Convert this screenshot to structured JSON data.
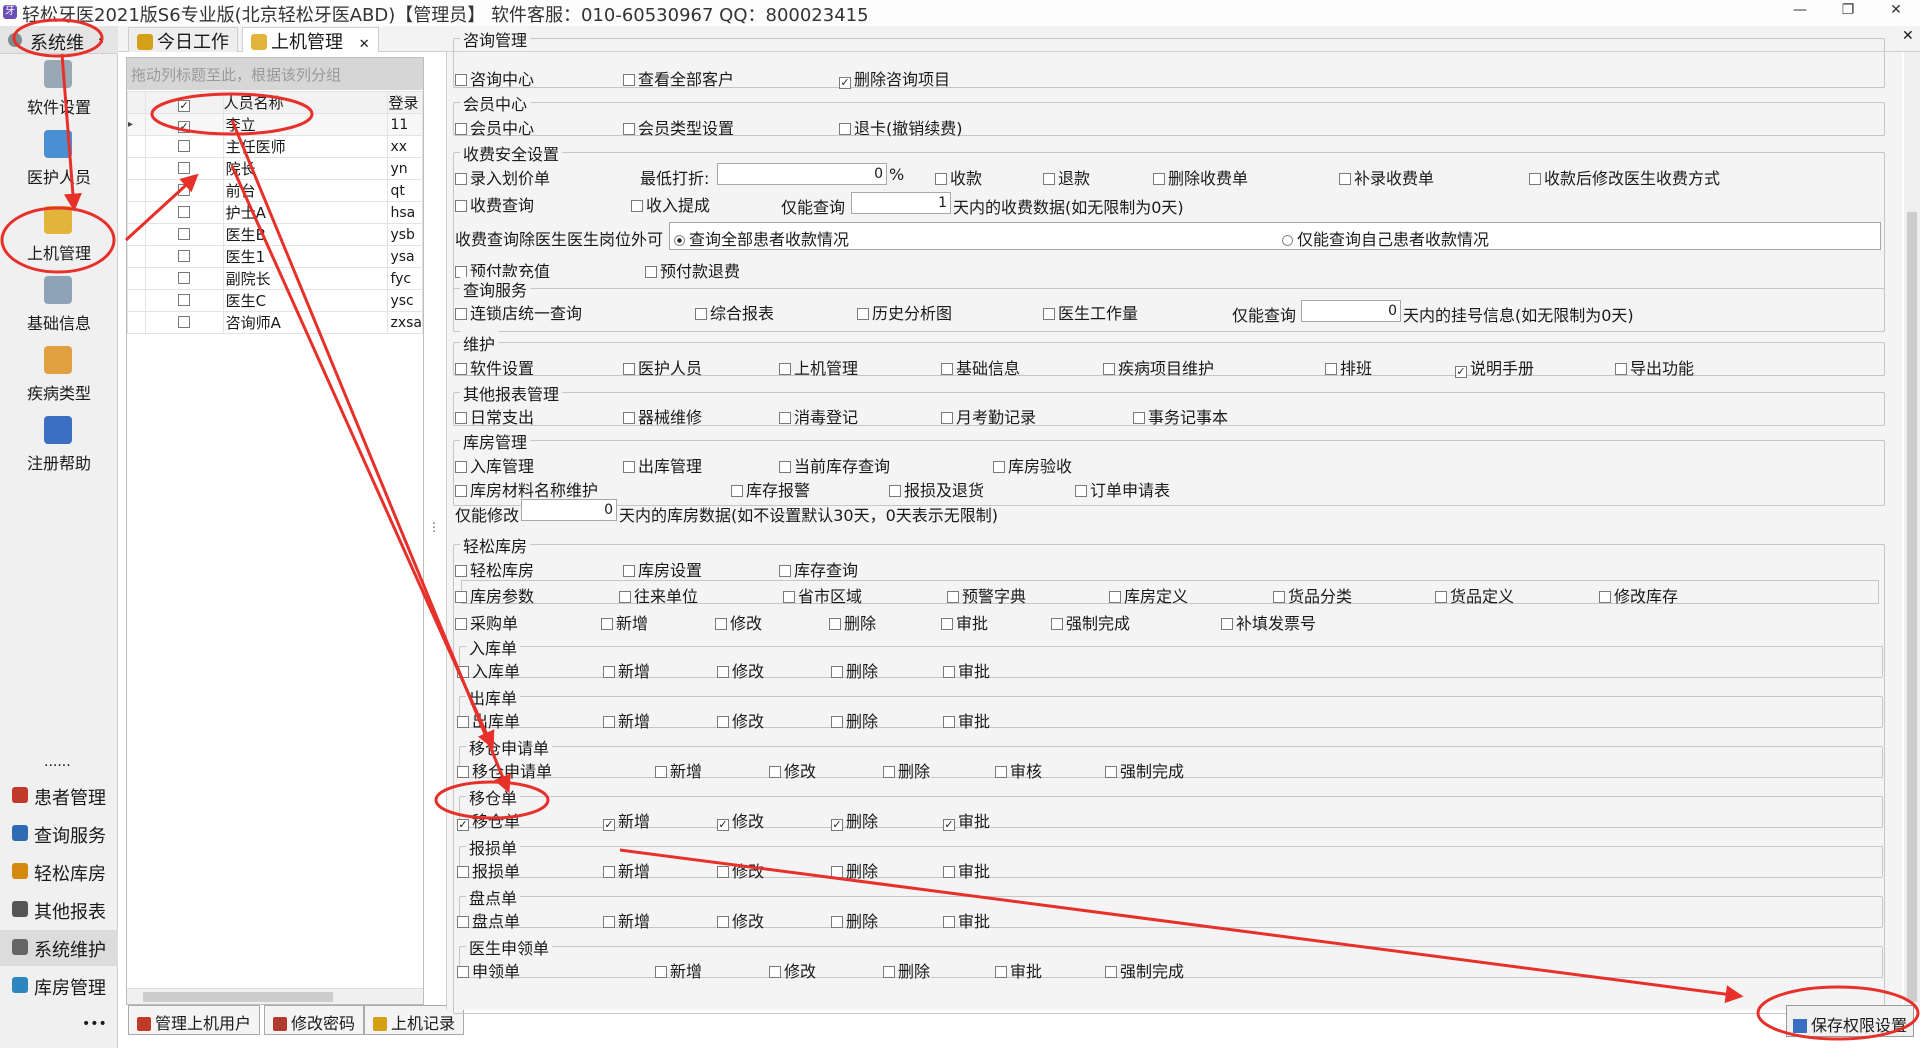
{
  "window": {
    "title": "轻松牙医2021版S6专业版(北京轻松牙医ABD)【管理员】   软件客服：010-60530967 QQ：800023415"
  },
  "leftnav": {
    "header": "系统维",
    "items": [
      {
        "label": "软件设置",
        "icon": "gear-icon"
      },
      {
        "label": "医护人员",
        "icon": "staff-icon"
      },
      {
        "label": "上机管理",
        "icon": "lock-icon"
      },
      {
        "label": "基础信息",
        "icon": "gears-icon"
      },
      {
        "label": "疾病类型",
        "icon": "tree-icon"
      },
      {
        "label": "注册帮助",
        "icon": "help-icon"
      }
    ],
    "dots": "......",
    "modules": [
      {
        "label": "患者管理",
        "color": "#c0392b"
      },
      {
        "label": "查询服务",
        "color": "#2e6bb5"
      },
      {
        "label": "轻松库房",
        "color": "#d68910"
      },
      {
        "label": "其他报表",
        "color": "#555555"
      },
      {
        "label": "系统维护",
        "color": "#666666"
      },
      {
        "label": "库房管理",
        "color": "#2e86c1"
      }
    ],
    "more": "•••"
  },
  "tabs": [
    {
      "label": "今日工作",
      "active": false
    },
    {
      "label": "上机管理",
      "active": true
    }
  ],
  "users": {
    "group_hint": "拖动列标题至此，根据该列分组",
    "col_name": "人员名称",
    "col_login": "登录",
    "rows": [
      {
        "name": "李立",
        "login": "11",
        "checked": true,
        "current": true
      },
      {
        "name": "主任医师",
        "login": "xx",
        "checked": false
      },
      {
        "name": "院长",
        "login": "yn",
        "checked": false
      },
      {
        "name": "前台",
        "login": "qt",
        "checked": false
      },
      {
        "name": "护士A",
        "login": "hsa",
        "checked": false
      },
      {
        "name": "医生B",
        "login": "ysb",
        "checked": false
      },
      {
        "name": "医生1",
        "login": "ysa",
        "checked": false
      },
      {
        "name": "副院长",
        "login": "fyc",
        "checked": false
      },
      {
        "name": "医生C",
        "login": "ysc",
        "checked": false
      },
      {
        "name": "咨询师A",
        "login": "zxsa",
        "checked": false
      }
    ]
  },
  "bottom_buttons": {
    "manage_users": "管理上机用户",
    "change_pwd": "修改密码",
    "login_log": "上机记录",
    "save": "保存权限设置"
  },
  "perm": {
    "consult": {
      "title": "咨询管理",
      "items": [
        {
          "label": "咨询中心",
          "checked": false
        },
        {
          "label": "查看全部客户",
          "checked": false
        },
        {
          "label": "删除咨询项目",
          "checked": true
        }
      ]
    },
    "member": {
      "title": "会员中心",
      "items": [
        {
          "label": "会员中心",
          "checked": false
        },
        {
          "label": "会员类型设置",
          "checked": false
        },
        {
          "label": "退卡(撤销续费)",
          "checked": false
        }
      ]
    },
    "fee": {
      "title": "收费安全设置",
      "row1": [
        {
          "label": "录入划价单",
          "checked": false
        },
        {
          "label": "收款",
          "checked": false
        },
        {
          "label": "退款",
          "checked": false
        },
        {
          "label": "删除收费单",
          "checked": false
        },
        {
          "label": "补录收费单",
          "checked": false
        },
        {
          "label": "收款后修改医生收费方式",
          "checked": false
        }
      ],
      "min_discount_label": "最低打折:",
      "min_discount_value": "0",
      "percent": "%",
      "row2": [
        {
          "label": "收费查询",
          "checked": false
        },
        {
          "label": "收入提成",
          "checked": false
        }
      ],
      "only_query": "仅能查询",
      "query_days": "1",
      "query_suffix": "天内的收费数据(如无限制为0天)",
      "scope_label": "收费查询除医生医生岗位外可",
      "scope_all": "查询全部患者收款情况",
      "scope_self": "仅能查询自己患者收款情况",
      "row3": [
        {
          "label": "预付款充值",
          "checked": false
        },
        {
          "label": "预付款退费",
          "checked": false
        }
      ]
    },
    "query": {
      "title": "查询服务",
      "items": [
        {
          "label": "连锁店统一查询",
          "checked": false
        },
        {
          "label": "综合报表",
          "checked": false
        },
        {
          "label": "历史分析图",
          "checked": false
        },
        {
          "label": "医生工作量",
          "checked": false
        }
      ],
      "only_query": "仅能查询",
      "days": "0",
      "suffix": "天内的挂号信息(如无限制为0天)"
    },
    "maint": {
      "title": "维护",
      "items": [
        {
          "label": "软件设置",
          "checked": false
        },
        {
          "label": "医护人员",
          "checked": false
        },
        {
          "label": "上机管理",
          "checked": false
        },
        {
          "label": "基础信息",
          "checked": false
        },
        {
          "label": "疾病项目维护",
          "checked": false
        },
        {
          "label": "排班",
          "checked": false
        },
        {
          "label": "说明手册",
          "checked": true
        },
        {
          "label": "导出功能",
          "checked": false
        }
      ]
    },
    "report": {
      "title": "其他报表管理",
      "items": [
        {
          "label": "日常支出",
          "checked": false
        },
        {
          "label": "器械维修",
          "checked": false
        },
        {
          "label": "消毒登记",
          "checked": false
        },
        {
          "label": "月考勤记录",
          "checked": false
        },
        {
          "label": "事务记事本",
          "checked": false
        }
      ]
    },
    "store": {
      "title": "库房管理",
      "row1": [
        {
          "label": "入库管理",
          "checked": false
        },
        {
          "label": "出库管理",
          "checked": false
        },
        {
          "label": "当前库存查询",
          "checked": false
        },
        {
          "label": "库房验收",
          "checked": false
        }
      ],
      "row2": [
        {
          "label": "库房材料名称维护",
          "checked": false
        },
        {
          "label": "库存报警",
          "checked": false
        },
        {
          "label": "报损及退货",
          "checked": false
        },
        {
          "label": "订单申请表",
          "checked": false
        }
      ],
      "only_edit": "仅能修改",
      "days": "0",
      "suffix": "天内的库房数据(如不设置默认30天，0天表示无限制)"
    },
    "easy": {
      "title": "轻松库房",
      "row1": [
        {
          "label": "轻松库房",
          "checked": false
        },
        {
          "label": "库房设置",
          "checked": false
        },
        {
          "label": "库存查询",
          "checked": false
        }
      ],
      "row2": [
        {
          "label": "库房参数",
          "checked": false
        },
        {
          "label": "往来单位",
          "checked": false
        },
        {
          "label": "省市区域",
          "checked": false
        },
        {
          "label": "预警字典",
          "checked": false
        },
        {
          "label": "库房定义",
          "checked": false
        },
        {
          "label": "货品分类",
          "checked": false
        },
        {
          "label": "货品定义",
          "checked": false
        },
        {
          "label": "修改库存",
          "checked": false
        }
      ],
      "purchase": [
        {
          "label": "采购单",
          "checked": false
        },
        {
          "label": "新增",
          "checked": false
        },
        {
          "label": "修改",
          "checked": false
        },
        {
          "label": "删除",
          "checked": false
        },
        {
          "label": "审批",
          "checked": false
        },
        {
          "label": "强制完成",
          "checked": false
        },
        {
          "label": "补填发票号",
          "checked": false
        }
      ],
      "inbound": {
        "title": "入库单",
        "items": [
          {
            "label": "入库单",
            "checked": false
          },
          {
            "label": "新增",
            "checked": false
          },
          {
            "label": "修改",
            "checked": false
          },
          {
            "label": "删除",
            "checked": false
          },
          {
            "label": "审批",
            "checked": false
          }
        ]
      },
      "outbound": {
        "title": "出库单",
        "items": [
          {
            "label": "出库单",
            "checked": false
          },
          {
            "label": "新增",
            "checked": false
          },
          {
            "label": "修改",
            "checked": false
          },
          {
            "label": "删除",
            "checked": false
          },
          {
            "label": "审批",
            "checked": false
          }
        ]
      },
      "move_req": {
        "title": "移仓申请单",
        "items": [
          {
            "label": "移仓申请单",
            "checked": false
          },
          {
            "label": "新增",
            "checked": false
          },
          {
            "label": "修改",
            "checked": false
          },
          {
            "label": "删除",
            "checked": false
          },
          {
            "label": "审核",
            "checked": false
          },
          {
            "label": "强制完成",
            "checked": false
          }
        ]
      },
      "move": {
        "title": "移仓单",
        "items": [
          {
            "label": "移仓单",
            "checked": true
          },
          {
            "label": "新增",
            "checked": true
          },
          {
            "label": "修改",
            "checked": true
          },
          {
            "label": "删除",
            "checked": true
          },
          {
            "label": "审批",
            "checked": true
          }
        ]
      },
      "loss": {
        "title": "报损单",
        "items": [
          {
            "label": "报损单",
            "checked": false
          },
          {
            "label": "新增",
            "checked": false
          },
          {
            "label": "修改",
            "checked": false
          },
          {
            "label": "删除",
            "checked": false
          },
          {
            "label": "审批",
            "checked": false
          }
        ]
      },
      "stock": {
        "title": "盘点单",
        "items": [
          {
            "label": "盘点单",
            "checked": false
          },
          {
            "label": "新增",
            "checked": false
          },
          {
            "label": "修改",
            "checked": false
          },
          {
            "label": "删除",
            "checked": false
          },
          {
            "label": "审批",
            "checked": false
          }
        ]
      },
      "doctor": {
        "title": "医生申领单",
        "items": [
          {
            "label": "申领单",
            "checked": false
          },
          {
            "label": "新增",
            "checked": false
          },
          {
            "label": "修改",
            "checked": false
          },
          {
            "label": "删除",
            "checked": false
          },
          {
            "label": "审批",
            "checked": false
          },
          {
            "label": "强制完成",
            "checked": false
          }
        ]
      }
    }
  },
  "annotation_color": "#e8302a"
}
